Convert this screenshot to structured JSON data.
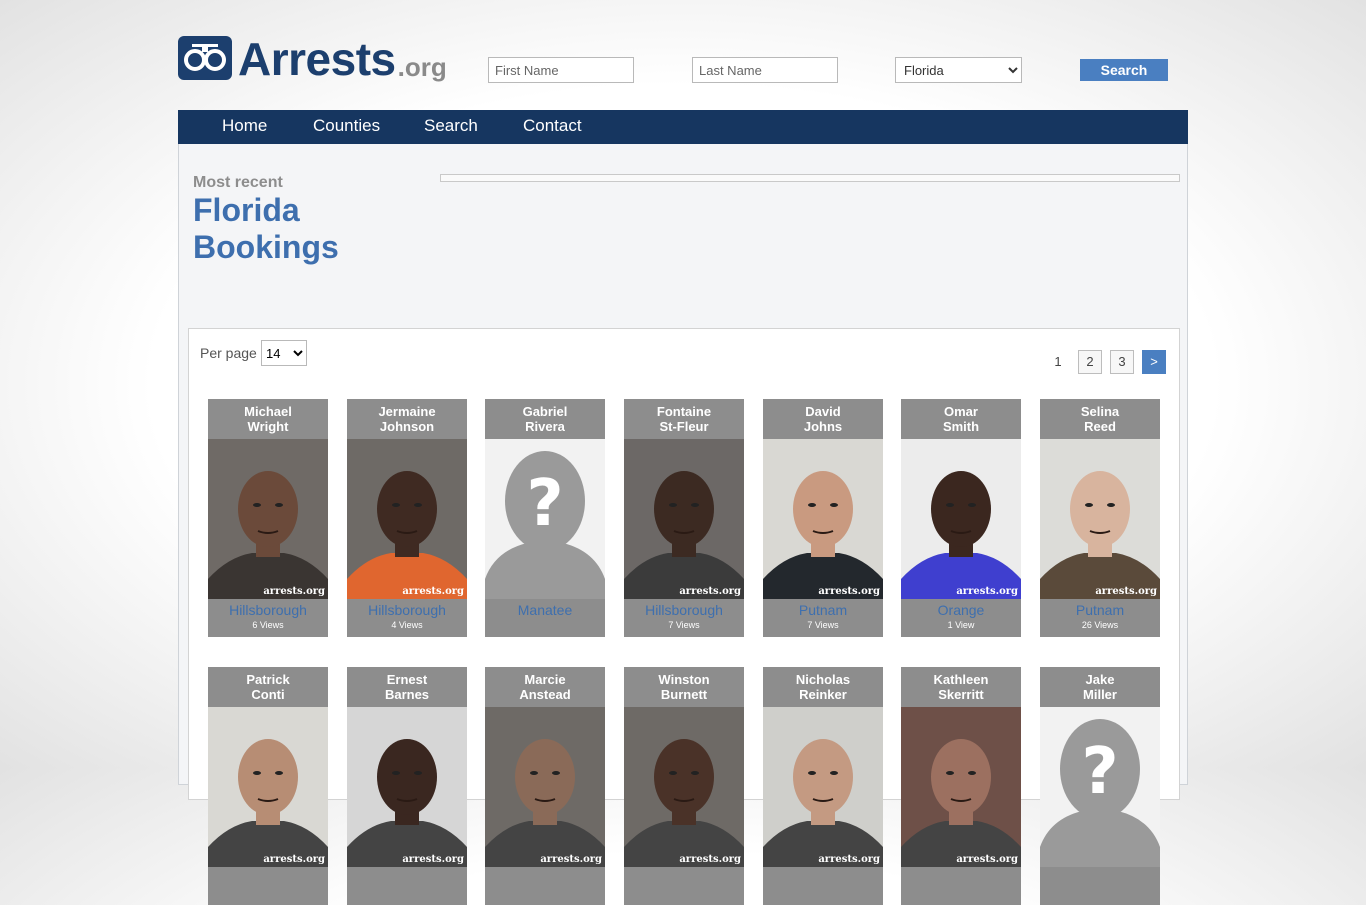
{
  "header": {
    "logo_text": "Arrests",
    "logo_tld": ".org",
    "first_name_placeholder": "First Name",
    "last_name_placeholder": "Last Name",
    "state_selected": "Florida",
    "search_label": "Search"
  },
  "nav": {
    "items": [
      "Home",
      "Counties",
      "Search",
      "Contact"
    ]
  },
  "main": {
    "subtitle": "Most recent",
    "title_line1": "Florida",
    "title_line2": "Bookings",
    "per_page_label": "Per page",
    "per_page_value": "14",
    "pagination": {
      "pages": [
        "1",
        "2",
        "3"
      ],
      "next": ">"
    }
  },
  "bookings": [
    {
      "first": "Michael",
      "last": "Wright",
      "county": "Hillsborough",
      "views": "6 Views",
      "photo": "mugshot",
      "skin": "#6b4a3a",
      "bg": "#6f6a66",
      "shirt": "#3a3532"
    },
    {
      "first": "Jermaine",
      "last": "Johnson",
      "county": "Hillsborough",
      "views": "4 Views",
      "photo": "mugshot",
      "skin": "#3f2a22",
      "bg": "#6e6a66",
      "shirt": "#e0662f"
    },
    {
      "first": "Gabriel",
      "last": "Rivera",
      "county": "Manatee",
      "views": "",
      "photo": "placeholder"
    },
    {
      "first": "Fontaine",
      "last": "St-Fleur",
      "county": "Hillsborough",
      "views": "7 Views",
      "photo": "mugshot",
      "skin": "#3c2a22",
      "bg": "#6c6866",
      "shirt": "#3b3b3b"
    },
    {
      "first": "David",
      "last": "Johns",
      "county": "Putnam",
      "views": "7 Views",
      "photo": "mugshot",
      "skin": "#c99a80",
      "bg": "#d9d8d3",
      "shirt": "#23282d"
    },
    {
      "first": "Omar",
      "last": "Smith",
      "county": "Orange",
      "views": "1 View",
      "photo": "mugshot",
      "skin": "#3b271f",
      "bg": "#ececec",
      "shirt": "#3f3fcf"
    },
    {
      "first": "Selina",
      "last": "Reed",
      "county": "Putnam",
      "views": "26 Views",
      "photo": "mugshot",
      "skin": "#d8b49e",
      "bg": "#dcdcd8",
      "shirt": "#5a4a3a"
    },
    {
      "first": "Patrick",
      "last": "Conti",
      "county": "",
      "views": "",
      "photo": "mugshot",
      "skin": "#b78d74",
      "bg": "#d9d8d3",
      "shirt": "#444444"
    },
    {
      "first": "Ernest",
      "last": "Barnes",
      "county": "",
      "views": "",
      "photo": "mugshot",
      "skin": "#3a2720",
      "bg": "#d6d6d6",
      "shirt": "#444444"
    },
    {
      "first": "Marcie",
      "last": "Anstead",
      "county": "",
      "views": "",
      "photo": "mugshot",
      "skin": "#8a6a58",
      "bg": "#6e6a66",
      "shirt": "#444444"
    },
    {
      "first": "Winston",
      "last": "Burnett",
      "county": "",
      "views": "",
      "photo": "mugshot",
      "skin": "#4a3228",
      "bg": "#6e6a66",
      "shirt": "#444444"
    },
    {
      "first": "Nicholas",
      "last": "Reinker",
      "county": "",
      "views": "",
      "photo": "mugshot",
      "skin": "#c49a82",
      "bg": "#cfcfcb",
      "shirt": "#444444"
    },
    {
      "first": "Kathleen",
      "last": "Skerritt",
      "county": "",
      "views": "",
      "photo": "mugshot",
      "skin": "#9c7060",
      "bg": "#6e5048",
      "shirt": "#444444"
    },
    {
      "first": "Jake",
      "last": "Miller",
      "county": "",
      "views": "",
      "photo": "placeholder"
    }
  ],
  "watermark": "arrests.org"
}
